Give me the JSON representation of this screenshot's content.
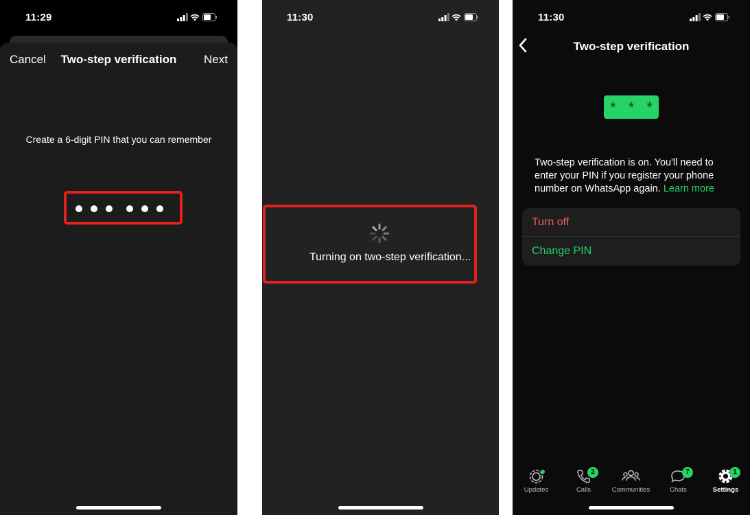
{
  "screen1": {
    "status_time": "11:29",
    "nav": {
      "cancel": "Cancel",
      "title": "Two-step verification",
      "next": "Next"
    },
    "prompt": "Create a 6-digit PIN that you can remember",
    "pin_entered_digits": 6
  },
  "screen2": {
    "status_time": "11:30",
    "loading_text": "Turning on two-step verification..."
  },
  "screen3": {
    "status_time": "11:30",
    "nav_title": "Two-step verification",
    "pin_badge": "* * *",
    "description": "Two-step verification is on. You'll need to enter your PIN if you register your phone number on WhatsApp again.",
    "learn_more": "Learn more",
    "actions": {
      "turn_off": "Turn off",
      "change_pin": "Change PIN"
    },
    "tabs": [
      {
        "label": "Updates",
        "icon": "updates-icon"
      },
      {
        "label": "Calls",
        "icon": "phone-icon",
        "badge": "2"
      },
      {
        "label": "Communities",
        "icon": "communities-icon"
      },
      {
        "label": "Chats",
        "icon": "chats-icon",
        "badge": "7"
      },
      {
        "label": "Settings",
        "icon": "gear-icon",
        "badge": "1"
      }
    ]
  },
  "colors": {
    "highlight_red": "#e4211c",
    "whatsapp_green": "#25d366",
    "danger_red": "#f15c6d"
  }
}
